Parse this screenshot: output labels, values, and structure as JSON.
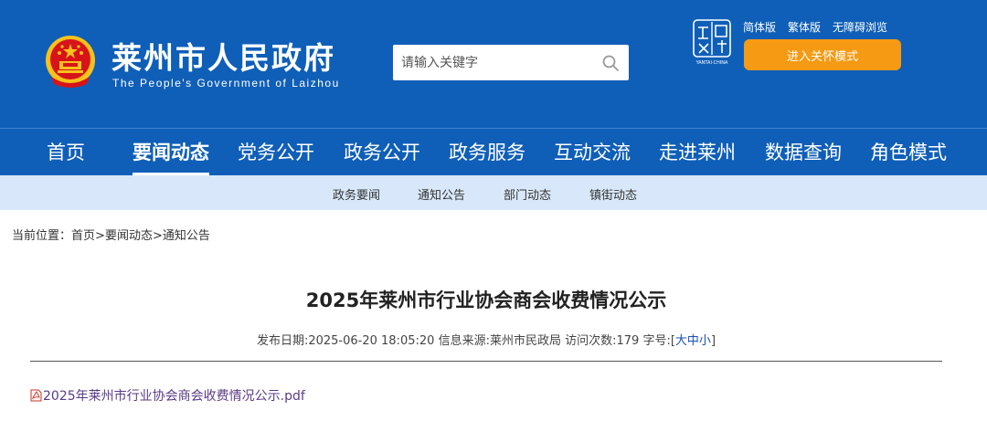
{
  "header": {
    "title": "莱州市人民政府",
    "subtitle": "The People's Government of Laizhou",
    "search_placeholder": "请输入关键字",
    "top_links": [
      "简体版",
      "繁体版",
      "无障碍浏览"
    ],
    "care_mode_label": "进入关怀模式",
    "city_logo_caption": "YANTAI·CHINA"
  },
  "nav": {
    "items": [
      "首页",
      "要闻动态",
      "党务公开",
      "政务公开",
      "政务服务",
      "互动交流",
      "走进莱州",
      "数据查询",
      "角色模式"
    ],
    "active_index": 1
  },
  "subnav": {
    "items": [
      "政务要闻",
      "通知公告",
      "部门动态",
      "镇街动态"
    ]
  },
  "breadcrumb": {
    "prefix": "当前位置：",
    "items": [
      "首页",
      "要闻动态",
      "通知公告"
    ],
    "separator": ">"
  },
  "article": {
    "title": "2025年莱州市行业协会商会收费情况公示",
    "meta_publish": "发布日期:2025-06-20 18:05:20",
    "meta_source": "信息来源:莱州市民政局",
    "meta_visits": "访问次数:179",
    "meta_fontsize_label": "字号:[",
    "fontsize_options": [
      "大",
      "中",
      "小"
    ],
    "meta_fontsize_close": "]",
    "attachment": "2025年莱州市行业协会商会收费情况公示.pdf"
  },
  "colors": {
    "header_bg": "#0f5fb8",
    "subnav_bg": "#d8e8fa",
    "care_button": "#f59a12",
    "emblem_red": "#d7141a",
    "emblem_gold": "#f7c21b"
  }
}
